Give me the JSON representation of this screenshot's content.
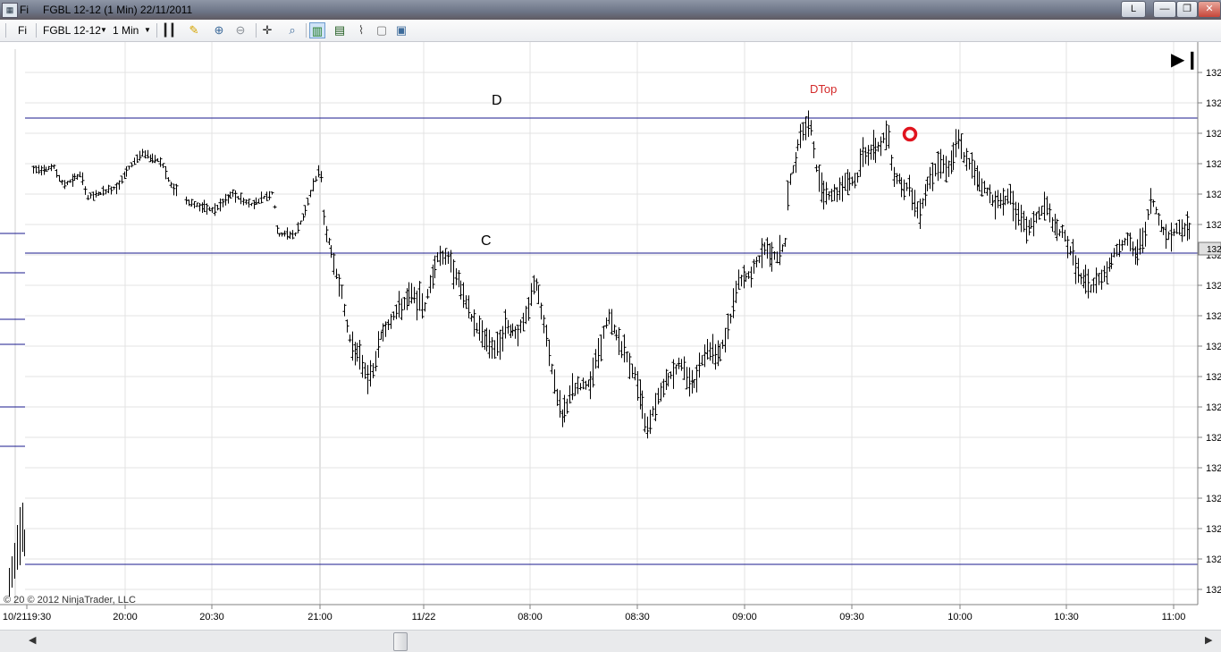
{
  "window": {
    "app_short": "Fi",
    "title": "FGBL 12-12 (1 Min)  22/11/2011",
    "buttons": [
      "L",
      "—",
      "❐",
      "✕"
    ]
  },
  "toolbar": {
    "panel_label": "Fi",
    "instrument": "FGBL 12-12",
    "interval": "1 Min"
  },
  "chart": {
    "annotations": {
      "d_label": "D",
      "c_label": "C",
      "dtop_label": "DTop",
      "dtop_color": "#d42a2a",
      "marker_color": "#e0141e"
    },
    "price_label": "132",
    "current_price_label": "132",
    "time_labels": [
      "10/2119:30",
      "20:00",
      "20:30",
      "21:00",
      "11/22",
      "08:00",
      "08:30",
      "09:00",
      "09:30",
      "10:00",
      "10:30",
      "11:00"
    ],
    "copyright": "© 20  © 2012 NinjaTrader, LLC",
    "line_color": "#1a1a8c",
    "bar_color": "#000000",
    "grid_color": "#e3e3e3"
  },
  "scrollbar": {
    "left_arrow": "◀",
    "right_arrow": "▶"
  }
}
